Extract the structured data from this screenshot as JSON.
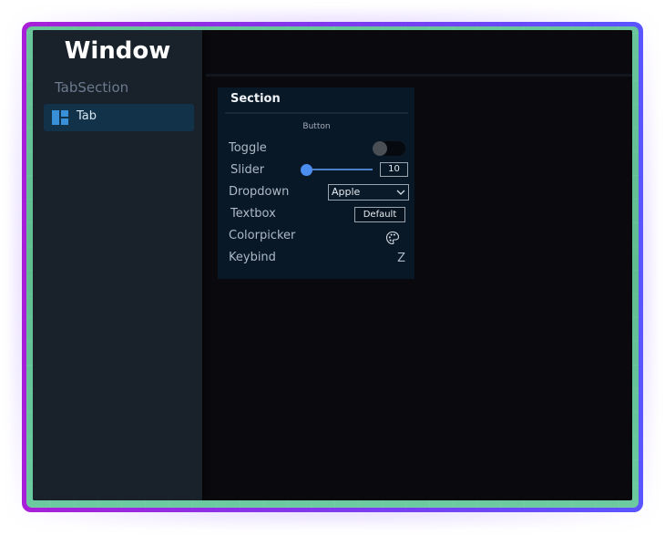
{
  "window": {
    "title": "Window"
  },
  "sidebar": {
    "section_label": "TabSection",
    "tabs": [
      {
        "label": "Tab",
        "icon": "layout-grid-icon",
        "active": true
      }
    ]
  },
  "section": {
    "title": "Section",
    "button_label": "Button",
    "toggle": {
      "label": "Toggle",
      "on": false
    },
    "slider": {
      "label": "Slider",
      "value": "10",
      "fraction": 0.0
    },
    "dropdown": {
      "label": "Dropdown",
      "selected": "Apple"
    },
    "textbox": {
      "label": "Textbox",
      "value": "Default"
    },
    "colorpicker": {
      "label": "Colorpicker",
      "icon": "palette-icon"
    },
    "keybind": {
      "label": "Keybind",
      "value": "Z"
    }
  },
  "colors": {
    "frame_gradient_start": "#a81fd8",
    "frame_gradient_end": "#5a55ff",
    "background_green": "#65c296",
    "accent_blue": "#4c8df0",
    "active_tab": "#12324a"
  }
}
